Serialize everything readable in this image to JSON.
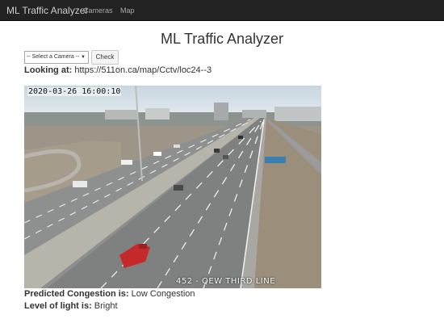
{
  "navbar": {
    "brand": "ML Traffic Analyzer",
    "links": [
      "Cameras",
      "Map"
    ]
  },
  "page": {
    "title": "ML Traffic Analyzer"
  },
  "controls": {
    "select_value": "-- Select a Camera --",
    "check_label": "Check"
  },
  "info": {
    "looking_label": "Looking at:",
    "looking_value": "https://511on.ca/map/Cctv/loc24--3",
    "congestion_label": "Predicted Congestion is:",
    "congestion_value": "Low Congestion",
    "light_label": "Level of light is:",
    "light_value": "Bright"
  },
  "camera": {
    "timestamp": "2020-03-26 16:00:10",
    "overlay_label": "452 - QEW THIRD LINE"
  },
  "colors": {
    "navbar_bg": "#222222",
    "navbar_text": "#a9a9a9",
    "text": "#333333"
  }
}
